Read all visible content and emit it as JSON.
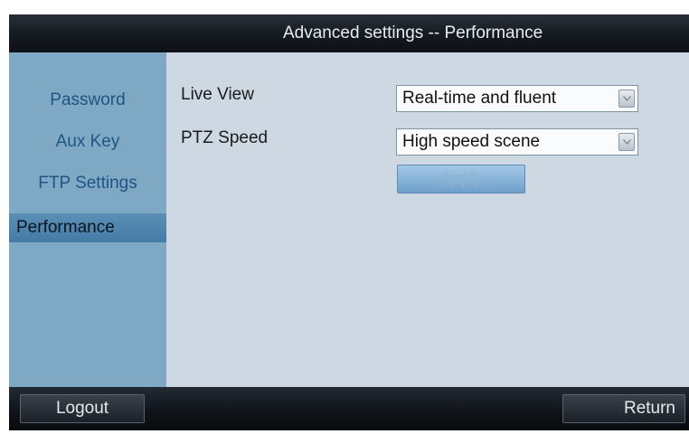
{
  "header": {
    "title": "Advanced settings -- Performance"
  },
  "sidebar": {
    "items": [
      {
        "label": "Password",
        "active": false
      },
      {
        "label": "Aux Key",
        "active": false
      },
      {
        "label": "FTP Settings",
        "active": false
      },
      {
        "label": "Performance",
        "active": true
      }
    ]
  },
  "form": {
    "live_view": {
      "label": "Live View",
      "value": "Real-time and fluent"
    },
    "ptz_speed": {
      "label": "PTZ Speed",
      "value": "High speed scene"
    },
    "apply_label": "Apply"
  },
  "footer": {
    "logout_label": "Logout",
    "return_label": "Return"
  },
  "colors": {
    "sidebar_bg": "#7fa8c4",
    "sidebar_active_bg": "#447ba5",
    "content_bg": "#cdd8e3",
    "bar_bg": "#0d1116"
  },
  "icons": {
    "dropdown": "chevron-down-icon"
  }
}
